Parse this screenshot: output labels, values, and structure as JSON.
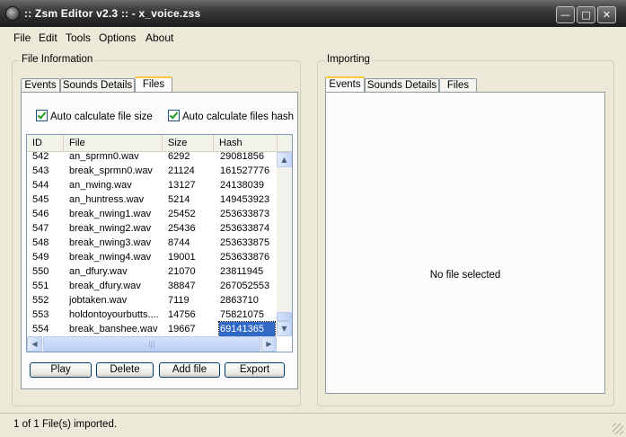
{
  "window": {
    "title": ":: Zsm Editor v2.3 :: - x_voice.zss"
  },
  "menu": [
    "File",
    "Edit",
    "Tools",
    "Options",
    "About"
  ],
  "left_group": {
    "title": "File Information",
    "tabs": [
      "Events",
      "Sounds Details",
      "Files"
    ],
    "active_tab": "Files",
    "auto_size_label": "Auto calculate file size",
    "auto_hash_label": "Auto calculate files hash",
    "columns": [
      "ID",
      "File",
      "Size",
      "Hash"
    ],
    "rows": [
      {
        "id": "542",
        "file": "an_sprmn0.wav",
        "size": "6292",
        "hash": "29081856"
      },
      {
        "id": "543",
        "file": "break_sprmn0.wav",
        "size": "21124",
        "hash": "161527776"
      },
      {
        "id": "544",
        "file": "an_nwing.wav",
        "size": "13127",
        "hash": "24138039"
      },
      {
        "id": "545",
        "file": "an_huntress.wav",
        "size": "5214",
        "hash": "149453923"
      },
      {
        "id": "546",
        "file": "break_nwing1.wav",
        "size": "25452",
        "hash": "253633873"
      },
      {
        "id": "547",
        "file": "break_nwing2.wav",
        "size": "25436",
        "hash": "253633874"
      },
      {
        "id": "548",
        "file": "break_nwing3.wav",
        "size": "8744",
        "hash": "253633875"
      },
      {
        "id": "549",
        "file": "break_nwing4.wav",
        "size": "19001",
        "hash": "253633876"
      },
      {
        "id": "550",
        "file": "an_dfury.wav",
        "size": "21070",
        "hash": "23811945"
      },
      {
        "id": "551",
        "file": "break_dfury.wav",
        "size": "38847",
        "hash": "267052553"
      },
      {
        "id": "552",
        "file": "jobtaken.wav",
        "size": "7119",
        "hash": "2863710"
      },
      {
        "id": "553",
        "file": "holdontoyourbutts....",
        "size": "14756",
        "hash": "75821075"
      },
      {
        "id": "554",
        "file": "break_banshee.wav",
        "size": "19667",
        "hash": "69141365"
      }
    ],
    "buttons": [
      "Play",
      "Delete",
      "Add file",
      "Export"
    ]
  },
  "right_group": {
    "title": "Importing",
    "tabs": [
      "Events",
      "Sounds Details",
      "Files"
    ],
    "active_tab": "Events",
    "empty_text": "No file selected"
  },
  "status": {
    "text": "1 of 1 File(s) imported."
  }
}
